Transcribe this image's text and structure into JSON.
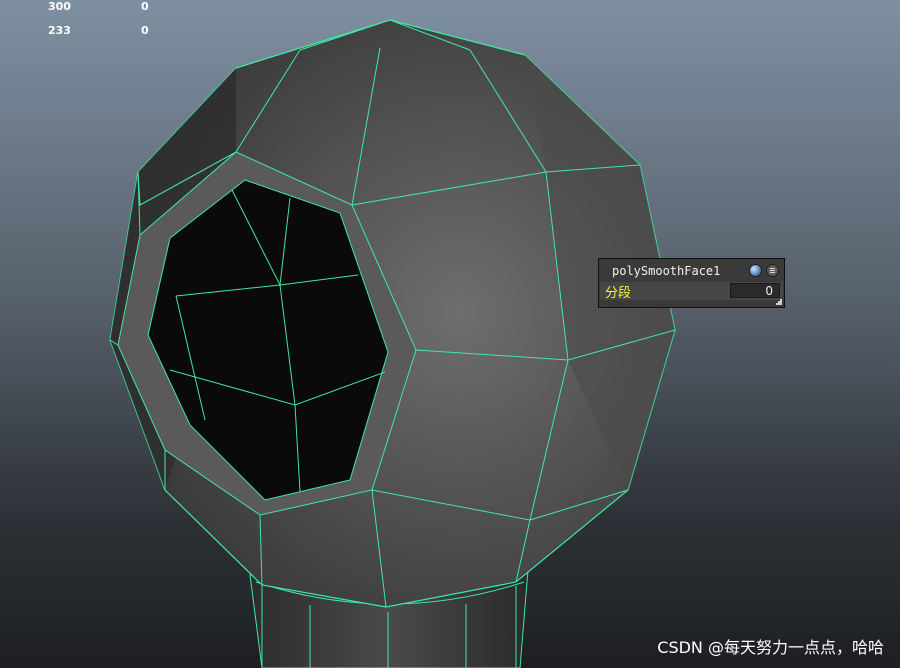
{
  "hud": {
    "rows": [
      {
        "col1": "300",
        "col2": "0"
      },
      {
        "col1": "233",
        "col2": "0"
      }
    ]
  },
  "node_panel": {
    "title": "polySmoothFace1",
    "attribute_label": "分段",
    "attribute_value": "0",
    "icons": [
      "lock-icon",
      "menu-icon",
      "resize-grip-icon"
    ]
  },
  "watermark": "CSDN @每天努力一点点，哈哈",
  "colors": {
    "wireframe": "#3ee8a6",
    "attribute_label": "#f6f14b",
    "panel_bg": "#3a3a3a"
  }
}
